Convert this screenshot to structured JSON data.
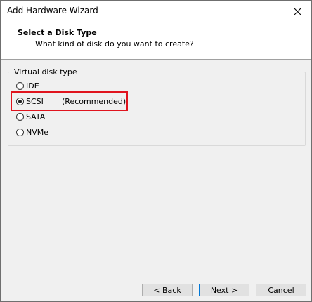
{
  "window": {
    "title": "Add Hardware Wizard"
  },
  "header": {
    "title": "Select a Disk Type",
    "subtitle": "What kind of disk do you want to create?"
  },
  "group": {
    "legend": "Virtual disk type",
    "options": [
      {
        "label": "IDE",
        "selected": false
      },
      {
        "label": "SCSI",
        "selected": true,
        "note": "(Recommended)"
      },
      {
        "label": "SATA",
        "selected": false
      },
      {
        "label": "NVMe",
        "selected": false
      }
    ]
  },
  "buttons": {
    "back": "< Back",
    "next": "Next >",
    "cancel": "Cancel"
  },
  "colors": {
    "highlight": "#e0141e",
    "default_button_border": "#0078d7"
  }
}
